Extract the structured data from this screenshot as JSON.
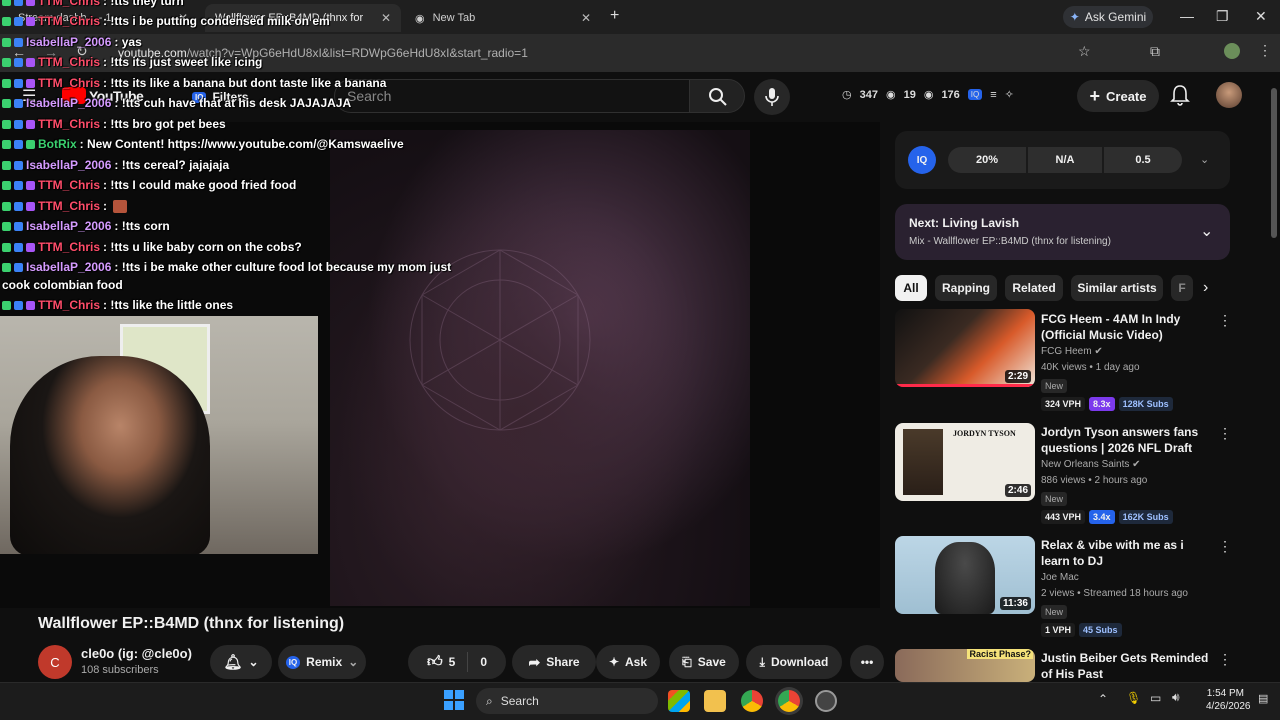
{
  "browser": {
    "tabs": [
      {
        "label": "Stream dashb... - 1"
      },
      {
        "label": "Wallflower EP::B4MD (thnx for l"
      },
      {
        "label": "New Tab"
      }
    ],
    "gemini_label": "Ask Gemini",
    "url_domain": "youtube.com",
    "url_rest": "/watch?v=WpG6eHdU8xI&list=RDWpG6eHdU8xI&start_radio=1"
  },
  "header": {
    "logo_text": "YouTube",
    "filters_label": "Filters",
    "search_placeholder": "Search",
    "stats": [
      "347",
      "19",
      "176"
    ],
    "create_label": "Create"
  },
  "chat": [
    {
      "user": "TTM_Chris",
      "text": ": !tts they turn",
      "type": "ttm"
    },
    {
      "user": "TTM_Chris",
      "text": ": !tts i be putting condensed milk on em",
      "type": "ttm"
    },
    {
      "user": "IsabellaP_2006",
      "text": ": yas",
      "type": "isa"
    },
    {
      "user": "TTM_Chris",
      "text": ": !tts its just sweet like icing",
      "type": "ttm"
    },
    {
      "user": "TTM_Chris",
      "text": ": !tts its like a banana but dont taste like a banana",
      "type": "ttm"
    },
    {
      "user": "IsabellaP_2006",
      "text": ": !tts cuh have that at his desk JAJAJAJA",
      "type": "isa"
    },
    {
      "user": "TTM_Chris",
      "text": ": !tts bro got pet bees",
      "type": "ttm"
    },
    {
      "user": "BotRix",
      "text": ": New Content! https://www.youtube.com/@Kamswaelive",
      "type": "bot"
    },
    {
      "user": "IsabellaP_2006",
      "text": ": !tts cereal? jajajaja",
      "type": "isa"
    },
    {
      "user": "TTM_Chris",
      "text": ": !tts I could make good fried food",
      "type": "ttm"
    },
    {
      "user": "TTM_Chris",
      "text": ":",
      "type": "ttm"
    },
    {
      "user": "IsabellaP_2006",
      "text": ": !tts corn",
      "type": "isa"
    },
    {
      "user": "TTM_Chris",
      "text": ": !tts u like baby corn on the cobs?",
      "type": "ttm"
    },
    {
      "user": "IsabellaP_2006",
      "text": ": !tts i be make other culture food lot because my mom just",
      "type": "isa"
    },
    {
      "user": "",
      "text": "cook colombian food",
      "type": "cont"
    },
    {
      "user": "TTM_Chris",
      "text": ": !tts like the little ones",
      "type": "ttm"
    }
  ],
  "video": {
    "title": "Wallflower EP::B4MD (thnx for listening)",
    "channel_initial": "C",
    "channel_name": "cle0o (ig: @cle0o)",
    "subscribers": "108 subscribers",
    "remix_label": "Remix",
    "likes": "5",
    "dislikes": "0",
    "share_label": "Share",
    "ask_label": "Ask",
    "save_label": "Save",
    "download_label": "Download"
  },
  "iq_panel": {
    "logo": "IQ",
    "values": [
      "20%",
      "N/A",
      "0.5"
    ]
  },
  "up_next": {
    "title": "Next: Living Lavish",
    "subtitle": "Mix - Wallflower EP::B4MD (thnx for listening)"
  },
  "chips": [
    "All",
    "Rapping",
    "Related",
    "Similar artists",
    "F"
  ],
  "recommendations": [
    {
      "title": "FCG Heem - 4AM In Indy (Official Music Video)",
      "channel": "FCG Heem",
      "meta": "40K views • 1 day ago",
      "duration": "2:29",
      "badge": "New",
      "vph": "324 VPH",
      "mult": "8.3x",
      "subs": "128K Subs",
      "mult_color": "#7c3aed"
    },
    {
      "title": "Jordyn Tyson answers fans questions | 2026 NFL Draft",
      "channel": "New Orleans Saints",
      "meta": "886 views • 2 hours ago",
      "duration": "2:46",
      "badge": "New",
      "vph": "443 VPH",
      "mult": "3.4x",
      "subs": "162K Subs",
      "mult_color": "#2563eb",
      "thumb_text": "JORDYN TYSON"
    },
    {
      "title": "Relax & vibe with me as i learn to DJ",
      "channel": "Joe Mac",
      "meta": "2 views • Streamed 18 hours ago",
      "duration": "11:36",
      "badge": "New",
      "vph": "1 VPH",
      "mult": "",
      "subs": "45 Subs",
      "mult_color": ""
    },
    {
      "title": "Justin Beiber Gets Reminded of His Past",
      "channel": "",
      "meta": "",
      "duration": "",
      "badge": "",
      "vph": "",
      "mult": "",
      "subs": "",
      "mult_color": "",
      "thumb_text": "Racist Phase?"
    }
  ],
  "taskbar": {
    "search_label": "Search",
    "time": "1:54 PM",
    "date": "4/26/2026"
  }
}
